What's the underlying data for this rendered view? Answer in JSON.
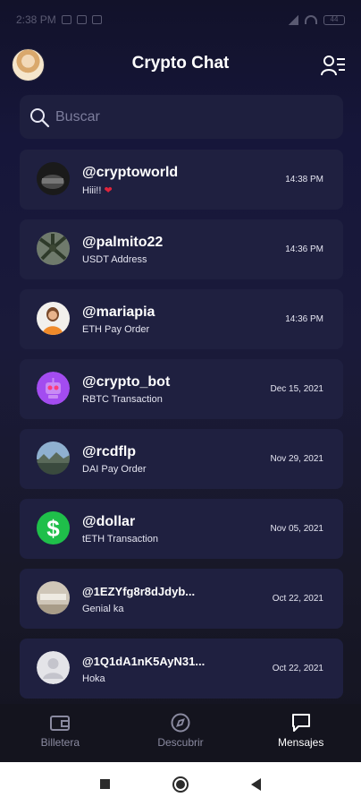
{
  "status_bar": {
    "time": "2:38 PM",
    "battery": "44"
  },
  "header": {
    "title": "Crypto Chat"
  },
  "search": {
    "placeholder": "Buscar"
  },
  "chats": [
    {
      "name": "@cryptoworld",
      "preview": "Hiii!! ",
      "preview_emoji": "❤",
      "time": "14:38 PM",
      "avatar": "dark-photo"
    },
    {
      "name": "@palmito22",
      "preview": "USDT Address",
      "preview_emoji": "",
      "time": "14:36 PM",
      "avatar": "palm-photo"
    },
    {
      "name": "@mariapia",
      "preview": "ETH Pay Order",
      "preview_emoji": "",
      "time": "14:36 PM",
      "avatar": "woman-photo"
    },
    {
      "name": "@crypto_bot",
      "preview": "RBTC Transaction",
      "preview_emoji": "",
      "time": "Dec 15, 2021",
      "avatar": "robot-icon"
    },
    {
      "name": "@rcdflp",
      "preview": "DAI Pay Order",
      "preview_emoji": "",
      "time": "Nov 29, 2021",
      "avatar": "landscape-photo"
    },
    {
      "name": "@dollar",
      "preview": "tETH Transaction",
      "preview_emoji": "",
      "time": "Nov 05, 2021",
      "avatar": "dollar-icon"
    },
    {
      "name": "@1EZYfg8r8dJdyb...",
      "preview": "Genial ka",
      "preview_emoji": "",
      "time": "Oct 22, 2021",
      "avatar": "sign-photo"
    },
    {
      "name": "@1Q1dA1nK5AyN31...",
      "preview": "Hoka",
      "preview_emoji": "",
      "time": "Oct 22, 2021",
      "avatar": "default-avatar"
    }
  ],
  "bottom_nav": [
    {
      "label": "Billetera",
      "icon": "wallet-icon",
      "active": false
    },
    {
      "label": "Descubrir",
      "icon": "compass-icon",
      "active": false
    },
    {
      "label": "Mensajes",
      "icon": "chat-bubble-icon",
      "active": true
    }
  ],
  "colors": {
    "background": "#16163a",
    "card": "#1f2040",
    "accent_bot": "#a34cf0",
    "accent_dollar": "#1fbf4a",
    "heart": "#e0243c"
  }
}
